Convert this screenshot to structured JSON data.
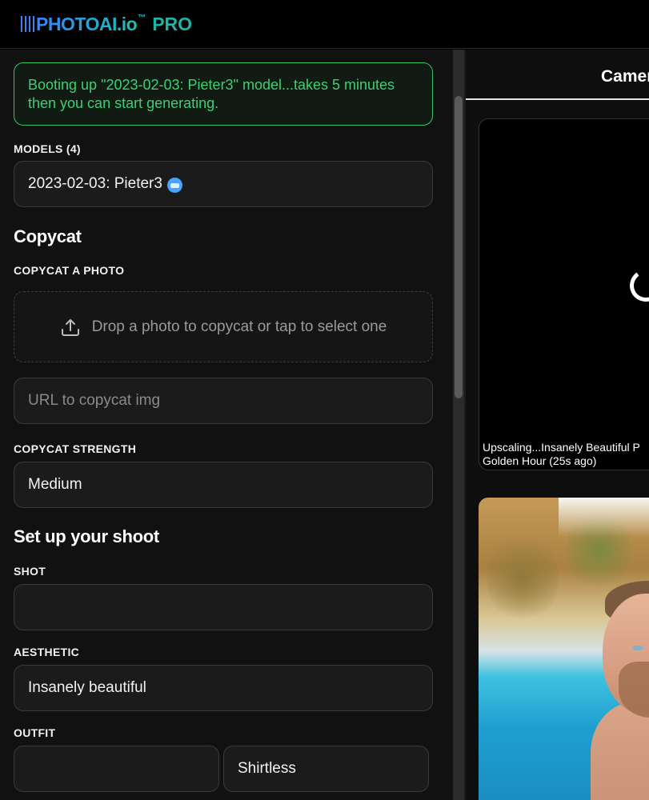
{
  "brand": {
    "word": "PHOTOAI.io",
    "tm": "™",
    "pro": "PRO"
  },
  "notice": {
    "text": "Booting up \"2023-02-03: Pieter3\" model...takes 5 minutes then you can start generating."
  },
  "models": {
    "label": "MODELS (4)",
    "selected": "2023-02-03: Pieter3"
  },
  "copycat": {
    "heading": "Copycat",
    "photo_label": "COPYCAT A PHOTO",
    "drop_text": "Drop a photo to copycat or tap to select one",
    "url_placeholder": "URL to copycat img",
    "strength_label": "COPYCAT STRENGTH",
    "strength_value": "Medium"
  },
  "shoot": {
    "heading": "Set up your shoot",
    "shot_label": "SHOT",
    "shot_value": "",
    "aesthetic_label": "AESTHETIC",
    "aesthetic_value": "Insanely beautiful",
    "outfit_label": "OUTFIT",
    "outfit_value_1": "",
    "outfit_value_2": "Shirtless"
  },
  "right": {
    "tab_label": "Camera",
    "card1_caption": "Upscaling...Insanely Beautiful P\nGolden Hour (25s ago)"
  },
  "colors": {
    "accent_green": "#3ecf73",
    "brand_blue": "#3b82f6",
    "brand_teal": "#20b3a8"
  }
}
